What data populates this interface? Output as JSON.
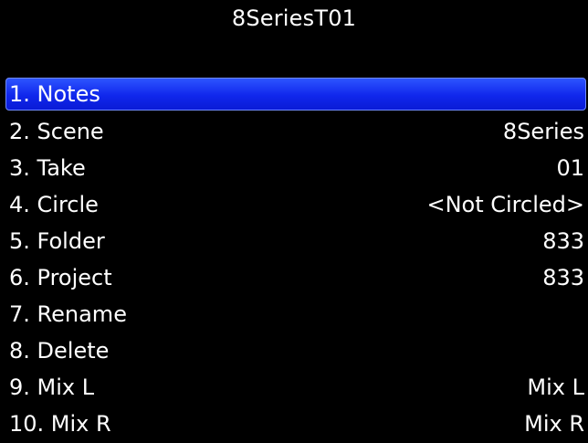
{
  "header": {
    "title": "8SeriesT01"
  },
  "colors": {
    "background": "#000000",
    "text": "#ffffff",
    "selection": "#1027ec"
  },
  "menu": {
    "items": [
      {
        "label": "1. Notes",
        "value": "",
        "selected": true
      },
      {
        "label": "2. Scene",
        "value": "8Series"
      },
      {
        "label": "3. Take",
        "value": "01"
      },
      {
        "label": "4. Circle",
        "value": "<Not Circled>"
      },
      {
        "label": "5. Folder",
        "value": "833"
      },
      {
        "label": "6. Project",
        "value": "833"
      },
      {
        "label": "7. Rename",
        "value": ""
      },
      {
        "label": "8. Delete",
        "value": ""
      },
      {
        "label": "9. Mix L",
        "value": "Mix L"
      },
      {
        "label": "10. Mix R",
        "value": "Mix R"
      }
    ]
  }
}
